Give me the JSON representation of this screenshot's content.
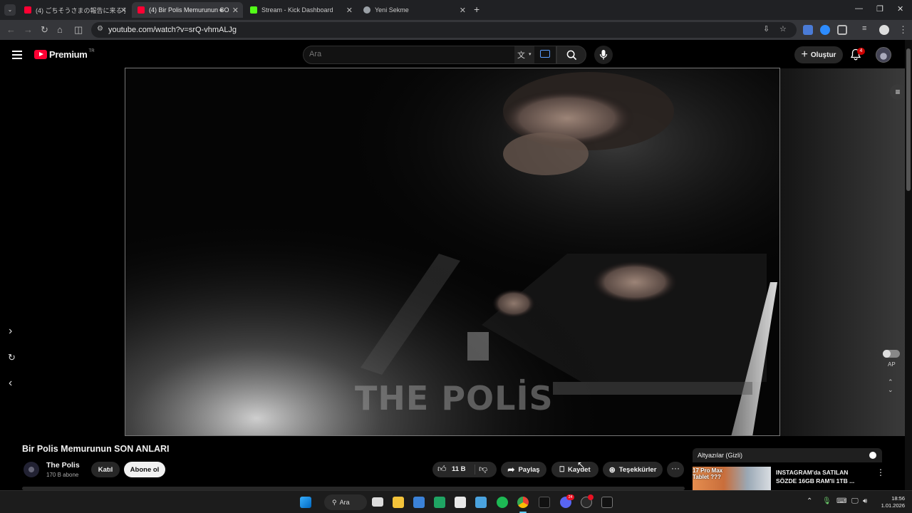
{
  "browser": {
    "tabs": [
      {
        "label": "(4) ごちそうさまの報告に来る子猫 [",
        "active": false,
        "favicon_color": "#ff0033"
      },
      {
        "label": "(4) Bir Polis Memurunun SO",
        "active": true,
        "favicon_color": "#ff0033"
      },
      {
        "label": "Stream - Kick Dashboard",
        "active": false,
        "favicon_color": "#53fc18"
      },
      {
        "label": "Yeni Sekme",
        "active": false,
        "favicon_color": "#9aa0a6"
      }
    ],
    "url": "youtube.com/watch?v=srQ-vhmALJg"
  },
  "youtube": {
    "logo_text": "Premium",
    "region": "TR",
    "search_placeholder": "Ara",
    "create_label": "Oluştur",
    "notifications_count": "4",
    "accent_color": "#ff0033"
  },
  "player": {
    "watermark": "THE POLİS",
    "autoplay_label": "AP"
  },
  "video": {
    "title": "Bir Polis Memurunun SON ANLARI",
    "channel_name": "The Polis",
    "channel_subs": "170 B abone",
    "join_label": "Katıl",
    "subscribe_label": "Abone ol",
    "likes": "11 B",
    "share_label": "Paylaş",
    "save_label": "Kaydet",
    "thanks_label": "Teşekkürler",
    "more_label": "···"
  },
  "sidebar": {
    "subtitles_label": "Altyazılar (Gizli)",
    "recommended": {
      "thumb_text_line1": "17 Pro Max",
      "thumb_text_line2": "Tablet ???",
      "title": "INSTAGRAM'da SATILAN SÖZDE 16GB RAM'li 1TB ..."
    }
  },
  "taskbar": {
    "search_label": "Ara",
    "discord_badge": "24",
    "time": "18:56",
    "date": "1.01.2026"
  }
}
